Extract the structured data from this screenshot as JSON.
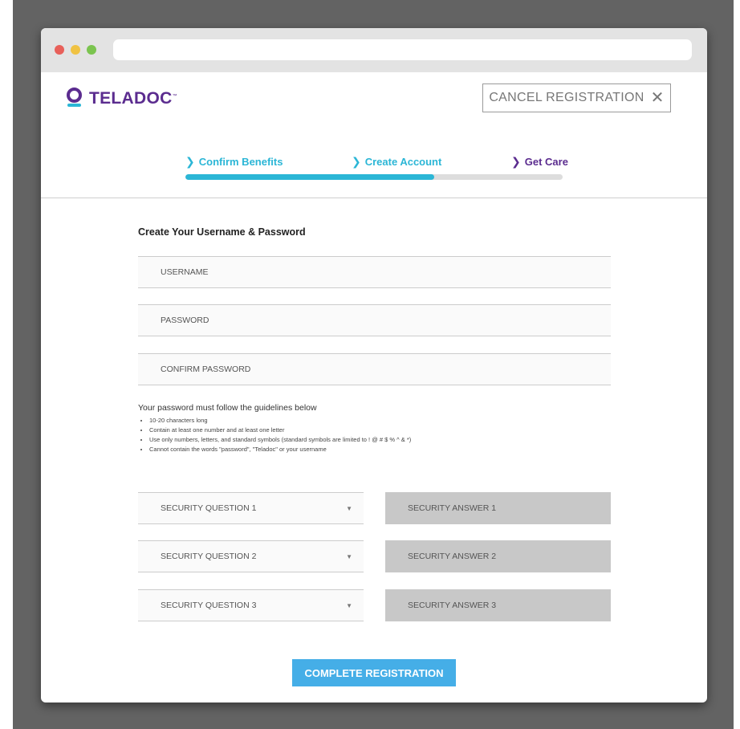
{
  "brand": {
    "name": "TELADOC",
    "trademark": "™",
    "primary_color": "#5b2c8f",
    "accent_color": "#2bb6d6"
  },
  "header": {
    "cancel_label": "CANCEL REGISTRATION",
    "cancel_icon": "close-icon"
  },
  "steps": [
    {
      "label": "Confirm Benefits",
      "icon": "chevron-right-icon"
    },
    {
      "label": "Create Account",
      "icon": "chevron-right-icon"
    },
    {
      "label": "Get Care",
      "icon": "chevron-right-icon"
    }
  ],
  "progress": {
    "fraction": 0.66
  },
  "form": {
    "title": "Create Your Username & Password",
    "username_placeholder": "USERNAME",
    "password_placeholder": "PASSWORD",
    "confirm_password_placeholder": "CONFIRM PASSWORD"
  },
  "guidelines": {
    "heading": "Your password must follow the guidelines below",
    "items": [
      "10-20 characters long",
      "Contain at least one number and at least one letter",
      "Use only numbers, letters, and standard symbols (standard symbols are limited to ! @ # $ % ^ & *)",
      "Cannot contain the words \"password\", \"Teladoc\" or your username"
    ]
  },
  "security": [
    {
      "question": "SECURITY QUESTION 1",
      "answer_placeholder": "SECURITY ANSWER 1"
    },
    {
      "question": "SECURITY QUESTION 2",
      "answer_placeholder": "SECURITY ANSWER 2"
    },
    {
      "question": "SECURITY QUESTION 3",
      "answer_placeholder": "SECURITY ANSWER 3"
    }
  ],
  "submit": {
    "label": "COMPLETE REGISTRATION"
  }
}
